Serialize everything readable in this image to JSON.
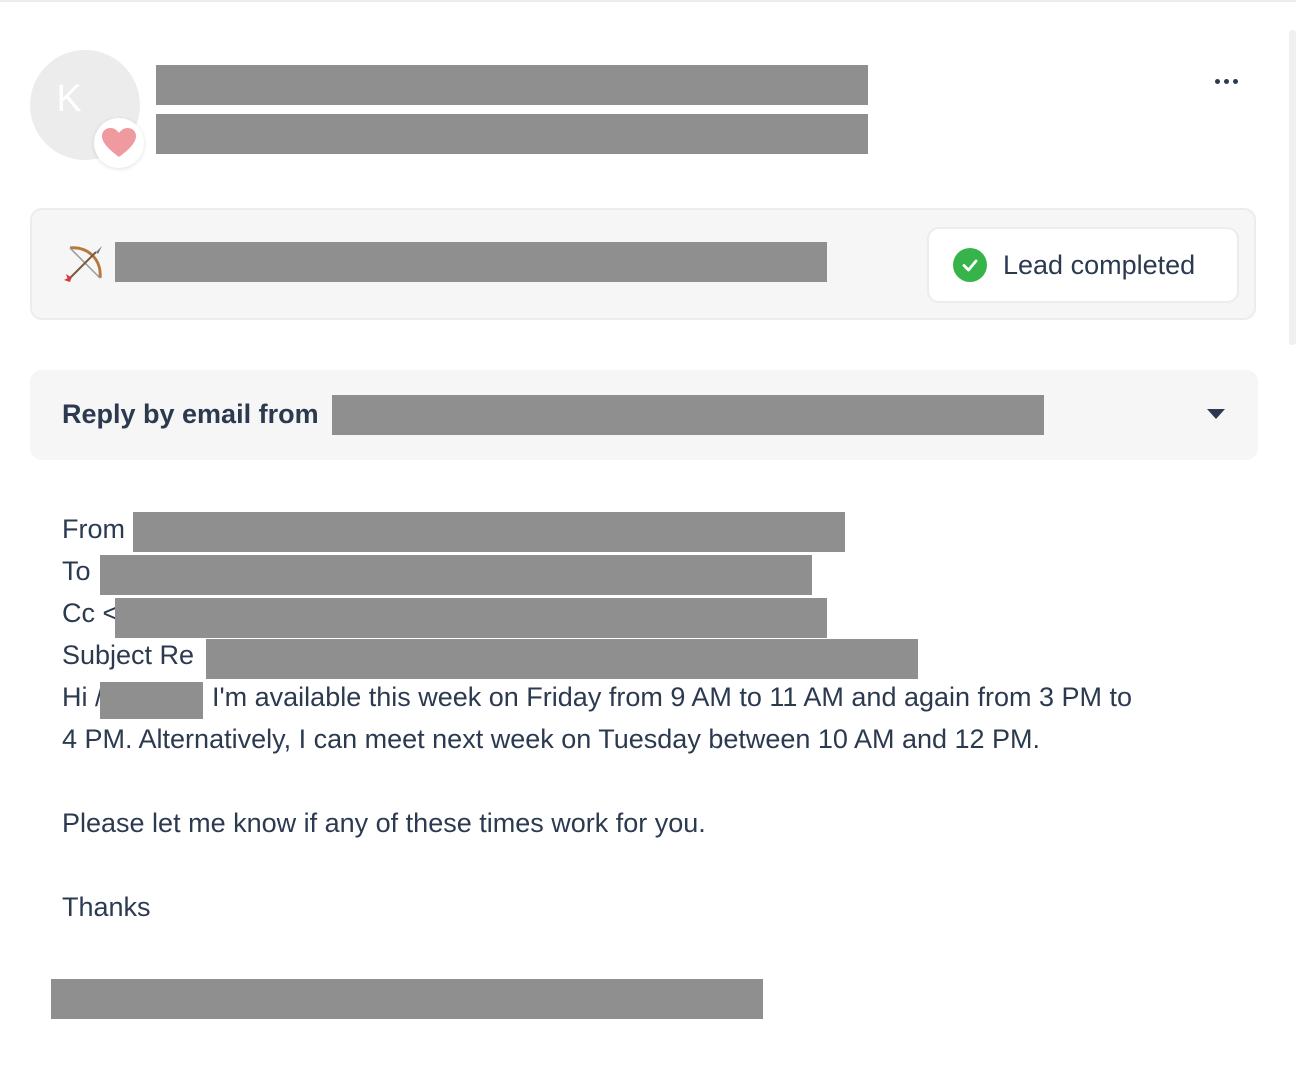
{
  "contact": {
    "avatar_initial": "K",
    "name": "",
    "subtitle": ""
  },
  "lead": {
    "title": "",
    "status": "Lead completed",
    "status_color": "#36b44a"
  },
  "reply": {
    "label": "Reply by email from",
    "sender": ""
  },
  "email": {
    "from_label": "From",
    "to_label": "To",
    "cc_label": "Cc <",
    "subject_label": "Subject Re",
    "greeting": "Hi /",
    "line1": "I'm available this week on Friday from 9 AM to 11 AM and again from 3 PM to",
    "line2": "4 PM. Alternatively, I can meet next week on Tuesday between 10 AM and 12 PM.",
    "line3": "Please let me know if any of these times work for you.",
    "closing": "Thanks",
    "signature": ""
  },
  "icons": {
    "avatar_badge": "heart-icon",
    "lead_icon": "bow-and-arrow-icon",
    "status_icon": "check-circle-icon",
    "more_icon": "more-horizontal-icon",
    "dropdown_icon": "caret-down-icon"
  }
}
